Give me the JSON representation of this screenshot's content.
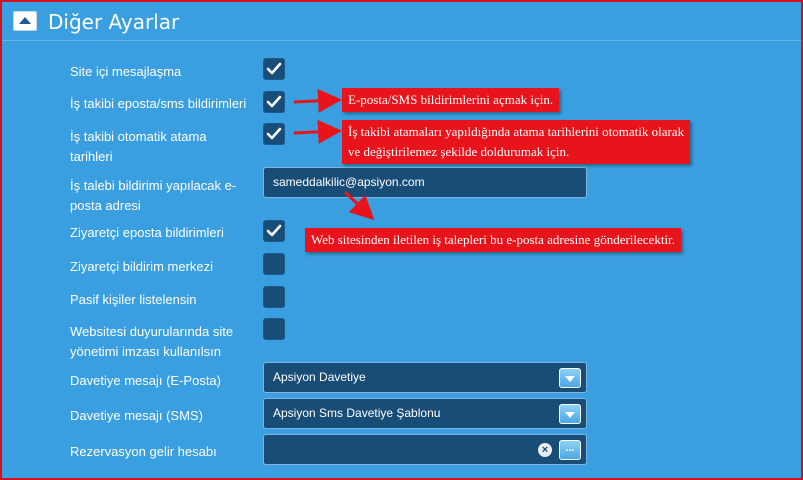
{
  "header": {
    "title": "Diğer Ayarlar",
    "collapse_icon": "chevron-up-icon"
  },
  "settings": {
    "site_messaging": {
      "label": "Site içi mesajlaşma",
      "checked": true
    },
    "job_email_sms": {
      "label": "İş takibi eposta/sms bildirimleri",
      "checked": true
    },
    "job_auto_assign_line1": "İş takibi otomatik atama",
    "job_auto_assign_line2": "tarihleri",
    "job_auto_assign_checked": true,
    "job_request_email_line1": "İş talebi bildirimi yapılacak e-",
    "job_request_email_line2": "posta adresi",
    "job_request_email_value": "sameddalkilic@apsiyon.com",
    "visitor_email": {
      "label": "Ziyaretçi eposta bildirimleri",
      "checked": true
    },
    "visitor_center": {
      "label": "Ziyaretçi bildirim merkezi",
      "checked": false
    },
    "passive_list": {
      "label": "Pasif kişiler listelensin",
      "checked": false
    },
    "website_signature_line1": "Websitesi duyurularında site",
    "website_signature_line2": "yönetimi imzası kullanılsın",
    "website_signature_checked": false,
    "invite_email": {
      "label": "Davetiye mesajı (E-Posta)",
      "value": "Apsiyon Davetiye"
    },
    "invite_sms": {
      "label": "Davetiye mesajı (SMS)",
      "value": "Apsiyon Sms Davetiye Şablonu"
    },
    "reservation_account": {
      "label": "Rezervasyon gelir hesabı",
      "value": ""
    }
  },
  "callouts": {
    "email_sms": "E-posta/SMS bildirimlerini açmak için.",
    "auto_assign_line1": "İş takibi atamaları yapıldığında atama tarihlerini otomatik olarak",
    "auto_assign_line2": "ve değiştirilemez şekilde doldurumak için.",
    "website_requests": "Web sitesinden iletilen iş talepleri bu e-posta adresine gönderilecektir."
  },
  "colors": {
    "background": "#3a9fe0",
    "border": "#d4101a",
    "field": "#184d78",
    "callout": "#e8141c"
  }
}
